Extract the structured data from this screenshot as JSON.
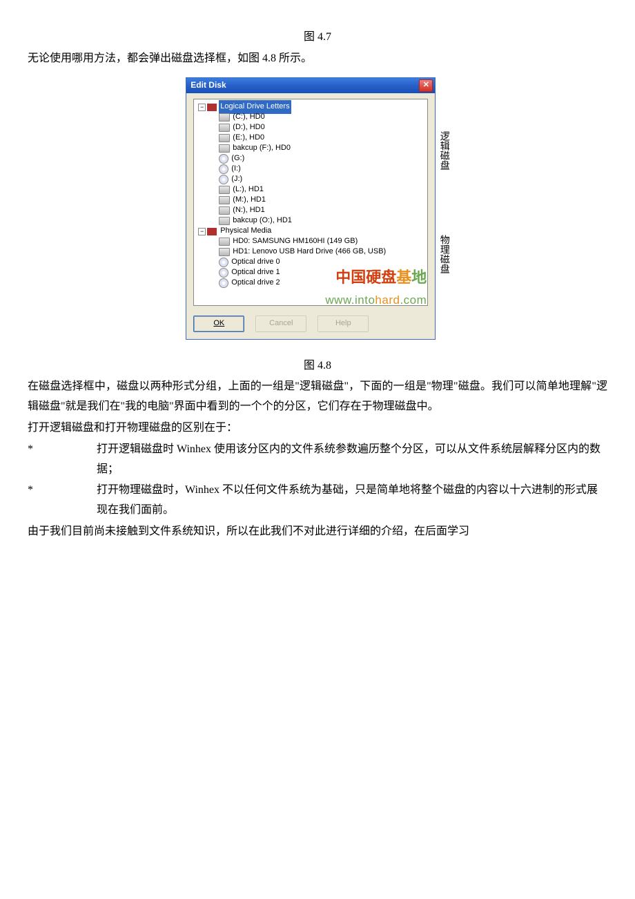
{
  "text": {
    "fig47": "图 4.7",
    "intro48": "无论使用哪用方法，都会弹出磁盘选择框，如图 4.8 所示。",
    "fig48": "图 4.8",
    "p1": "在磁盘选择框中，磁盘以两种形式分组，上面的一组是\"逻辑磁盘\"，下面的一组是\"物理\"磁盘。我们可以简单地理解\"逻辑磁盘\"就是我们在\"我的电脑\"界面中看到的一个个的分区，它们存在于物理磁盘中。",
    "p2": "打开逻辑磁盘和打开物理磁盘的区别在于：",
    "b1": "打开逻辑磁盘时 Winhex 使用该分区内的文件系统参数遍历整个分区，可以从文件系统层解释分区内的数据；",
    "b2": "打开物理磁盘时，Winhex 不以任何文件系统为基础，只是简单地将整个磁盘的内容以十六进制的形式展现在我们面前。",
    "p3": "由于我们目前尚未接触到文件系统知识，所以在此我们不对此进行详细的介绍，在后面学习",
    "star": "*"
  },
  "dialog": {
    "title": "Edit Disk",
    "close": "✕",
    "logical_header": "Logical Drive Letters",
    "physical_header": "Physical Media",
    "logical": [
      "(C:), HD0",
      "(D:), HD0",
      "(E:), HD0",
      "bakcup (F:), HD0",
      "(G:)",
      "(I:)",
      "(J:)",
      "(L:), HD1",
      "(M:), HD1",
      "(N:), HD1",
      "bakcup (O:), HD1"
    ],
    "physical": [
      "HD0: SAMSUNG HM160HI (149 GB)",
      "HD1: Lenovo USB Hard Drive (466 GB, USB)",
      "Optical drive 0",
      "Optical drive 1",
      "Optical drive 2"
    ],
    "ok": "OK",
    "cancel": "Cancel",
    "help": "Help",
    "watermark1a": "中国硬盘",
    "watermark1b": "基",
    "watermark1c": "地",
    "watermark2a": "www.into",
    "watermark2b": "hard",
    "watermark2c": ".com"
  },
  "side": {
    "logical": "逻辑磁盘",
    "physical": "物理磁盘"
  }
}
